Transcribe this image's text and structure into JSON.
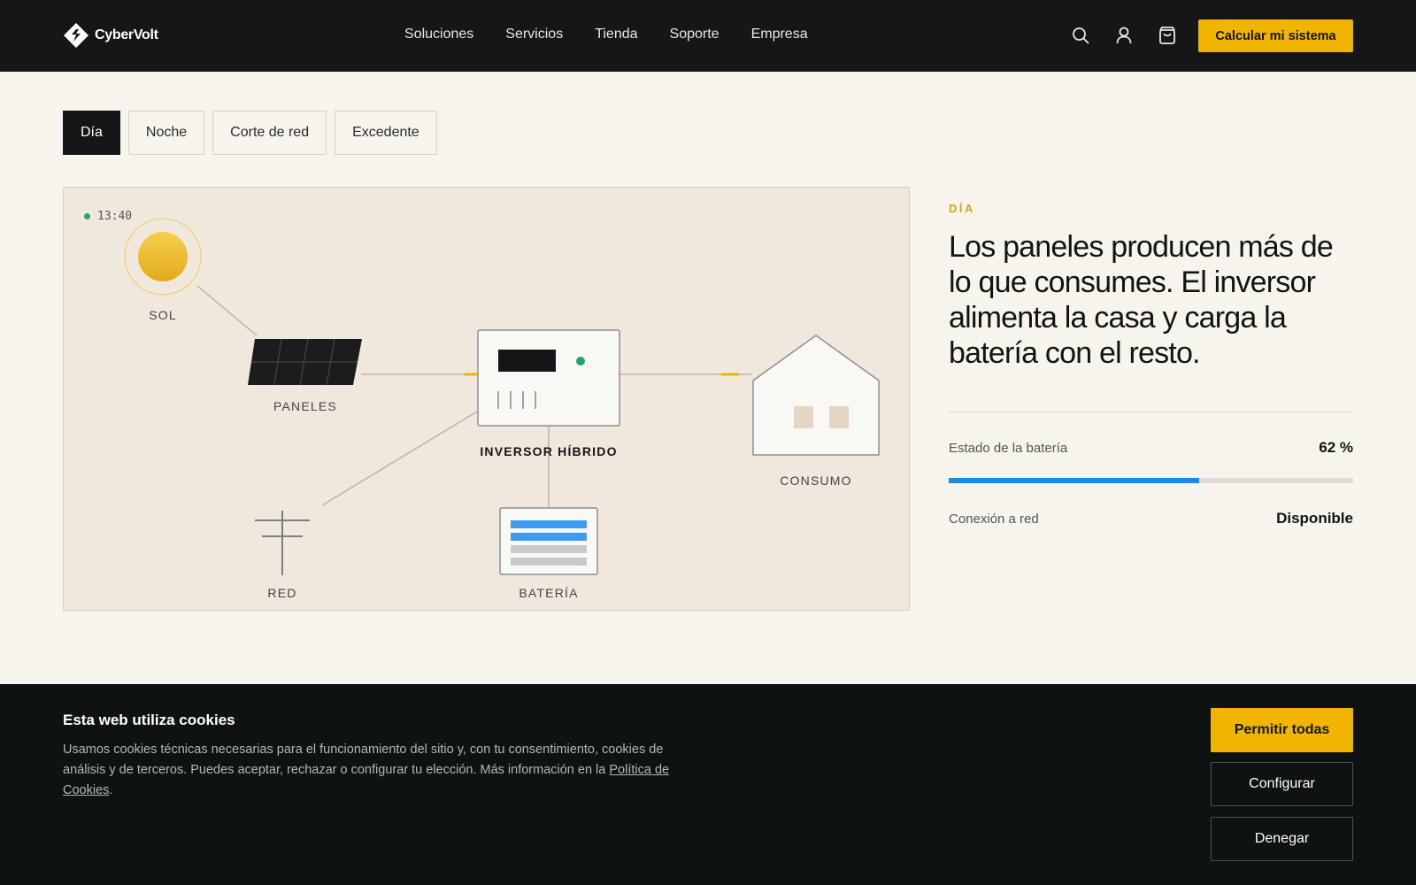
{
  "brand": {
    "name": "CyberVolt",
    "accent": "#f1b400"
  },
  "nav": {
    "items": [
      "Soluciones",
      "Servicios",
      "Tienda",
      "Soporte",
      "Empresa"
    ]
  },
  "header": {
    "icons": [
      "search-icon",
      "user-icon",
      "cart-icon"
    ],
    "cta_label": "Calcular mi sistema"
  },
  "tabs": [
    {
      "label": "Día",
      "active": true
    },
    {
      "label": "Noche",
      "active": false
    },
    {
      "label": "Corte de red",
      "active": false
    },
    {
      "label": "Excedente",
      "active": false
    }
  ],
  "diagram": {
    "time": "13:40",
    "labels": {
      "sun": "SOL",
      "panels": "PANELES",
      "inverter": "INVERSOR HÍBRIDO",
      "consumption": "CONSUMO",
      "grid": "RED",
      "battery": "BATERÍA"
    }
  },
  "panel": {
    "eyebrow": "DÍA",
    "headline": "Los paneles producen más de lo que consumes. El inversor alimenta la casa y carga la batería con el resto.",
    "battery_label": "Estado de la batería",
    "battery_value": "62 %",
    "battery_percent": 62,
    "grid_label": "Conexión a red",
    "grid_value": "Disponible",
    "progress_color": "#1e88e5"
  },
  "cookies": {
    "title": "Esta web utiliza cookies",
    "text_before": "Usamos cookies técnicas necesarias para el funcionamiento del sitio y, con tu consentimiento, cookies de análisis y de terceros. Puedes aceptar, rechazar o configurar tu elección. Más información en la ",
    "link_label": "Política de Cookies",
    "text_after": ".",
    "allow_label": "Permitir todas",
    "configure_label": "Configurar",
    "deny_label": "Denegar"
  }
}
